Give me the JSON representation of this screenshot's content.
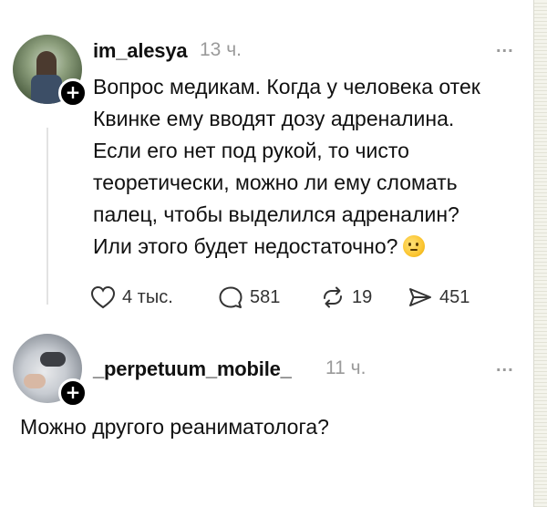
{
  "posts": [
    {
      "username": "im_alesya",
      "time": "13 ч.",
      "more": "...",
      "avatar_icon": "user-avatar-icon",
      "follow_icon": "+",
      "text_lines": [
        "Вопрос медикам. Когда у человека отек",
        "Квинке ему вводят дозу адреналина.",
        "Если его нет под рукой, то чисто",
        "теоретически, можно ли ему сломать",
        "палец, чтобы выделился адреналин?",
        "Или этого будет недостаточно?"
      ],
      "emoji": "thinking-face-emoji",
      "actions": {
        "likes": "4 тыс.",
        "comments": "581",
        "reposts": "19",
        "shares": "451"
      }
    },
    {
      "username": "_perpetuum_mobile_",
      "time": "11 ч.",
      "more": "...",
      "avatar_icon": "user-avatar-icon",
      "follow_icon": "+",
      "text": "Можно другого реаниматолога?"
    }
  ],
  "colors": {
    "text": "#111111",
    "muted": "#9a9a9a",
    "thread_line": "#e3e3e3",
    "badge": "#000000"
  }
}
